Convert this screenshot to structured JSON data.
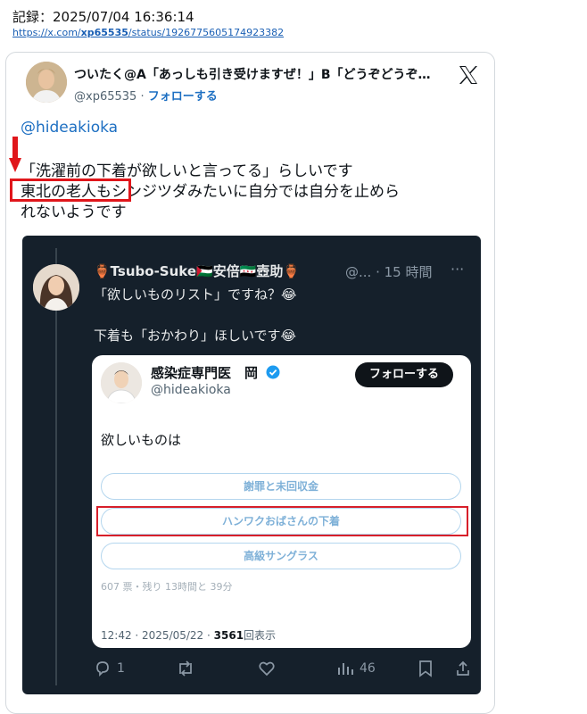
{
  "record": {
    "line": "記録：2025/07/04 16:36:14",
    "url_prefix": "https://x.com/",
    "url_user": "xp65535",
    "url_suffix": "/status/1926775605174923382"
  },
  "tweet": {
    "author_name": "ついたく@A「あっしも引き受けますぜ！」B「どうぞどうぞ…",
    "author_handle": "@xp65535",
    "separator": " · ",
    "follow_label": "フォローする",
    "mention": "@hideakioka",
    "body_line1": "「洗濯前の下着が欲しいと言ってる」らしいです",
    "body_line2": "東北の老人もシンジツダみたいに自分では自分を止めら",
    "body_line3": "れないようです"
  },
  "quoted": {
    "author_name": "🏺Tsubo-Suke🇵🇸安倍🇸🇾壺助🏺",
    "author_meta": "@... · 15 時間",
    "more": "···",
    "line1": "「欲しいものリスト」ですね？😂",
    "line2": "下着も「おかわり」ほしいです😂"
  },
  "poll": {
    "author_name": "感染症専門医　岡",
    "author_handle": "@hideakioka",
    "follow_label": "フォローする",
    "question": "欲しいものは",
    "options": [
      "謝罪と未回収金",
      "ハンワクおばさんの下着",
      "高級サングラス"
    ],
    "votes": "607 票・残り 13時間と 39分",
    "time": "12:42 · 2025/05/22 · ",
    "views": "3561",
    "views_suffix": "回表示"
  },
  "actions": {
    "reply_count": "1",
    "views_count": "46"
  },
  "colors": {
    "link": "#1d6fc2",
    "highlight": "#e0161b",
    "embed_bg": "#15202b"
  }
}
